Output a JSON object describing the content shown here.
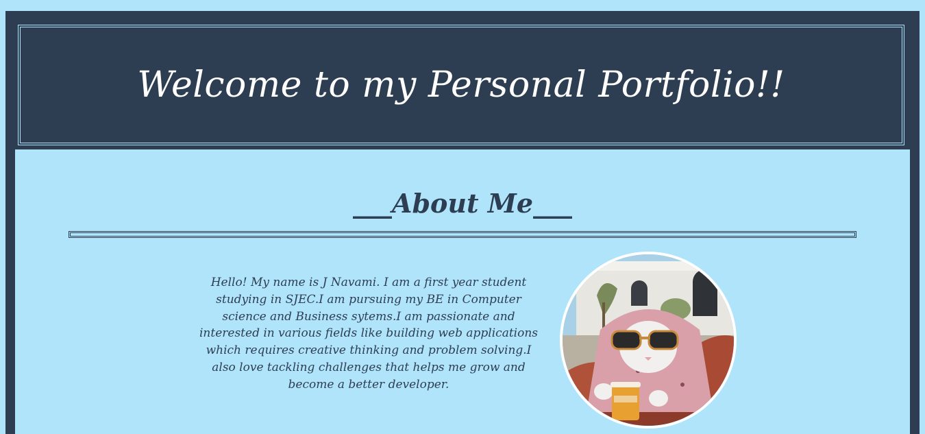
{
  "header": {
    "title": "Welcome to my Personal Portfolio!!"
  },
  "about": {
    "heading": "___About Me___",
    "bio": "Hello! My name is J Navami. I am a first year student studying in SJEC.I am pursuing my BE in Computer science and Business sytems.I am passionate and interested in various fields like building web applications which requires creative thinking and problem solving.I also love tackling challenges that helps me grow and become a better developer.",
    "photo_icon": "profile-photo-cat-with-sunglasses"
  },
  "colors": {
    "dark_navy": "#2d3e52",
    "light_blue": "#b0e4fb",
    "white": "#ffffff"
  }
}
